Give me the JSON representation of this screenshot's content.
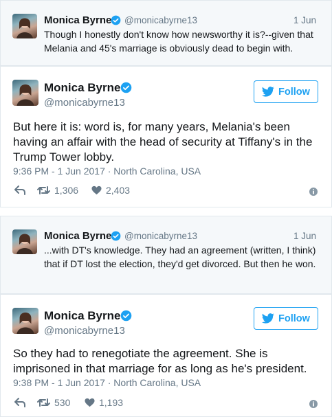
{
  "colors": {
    "brand": "#1da1f2",
    "muted": "#657786",
    "text": "#14171a",
    "context_bg": "#f5f8fa"
  },
  "thread": [
    {
      "context": {
        "name": "Monica Byrne",
        "handle": "@monicabyrne13",
        "date": "1 Jun",
        "text": "Though I honestly don't know how newsworthy it is?--given that Melania and 45's marriage is obviously dead to begin with."
      },
      "tweet": {
        "name": "Monica Byrne",
        "handle": "@monicabyrne13",
        "follow_label": "Follow",
        "text": "But here it is: word is, for many years, Melania's been having an affair with the head of security at Tiffany's in the Trump Tower lobby.",
        "timestamp": "9:36 PM - 1 Jun 2017 · North Carolina, USA",
        "retweets": "1,306",
        "likes": "2,403"
      }
    },
    {
      "context": {
        "name": "Monica Byrne",
        "handle": "@monicabyrne13",
        "date": "1 Jun",
        "text": "...with DT's knowledge. They had an agreement (written, I think) that if DT lost the election, they'd get divorced. But then he won."
      },
      "tweet": {
        "name": "Monica Byrne",
        "handle": "@monicabyrne13",
        "follow_label": "Follow",
        "text": "So they had to renegotiate the agreement. She is imprisoned in that marriage for as long as he's president.",
        "timestamp": "9:38 PM - 1 Jun 2017 · North Carolina, USA",
        "retweets": "530",
        "likes": "1,193"
      }
    }
  ]
}
